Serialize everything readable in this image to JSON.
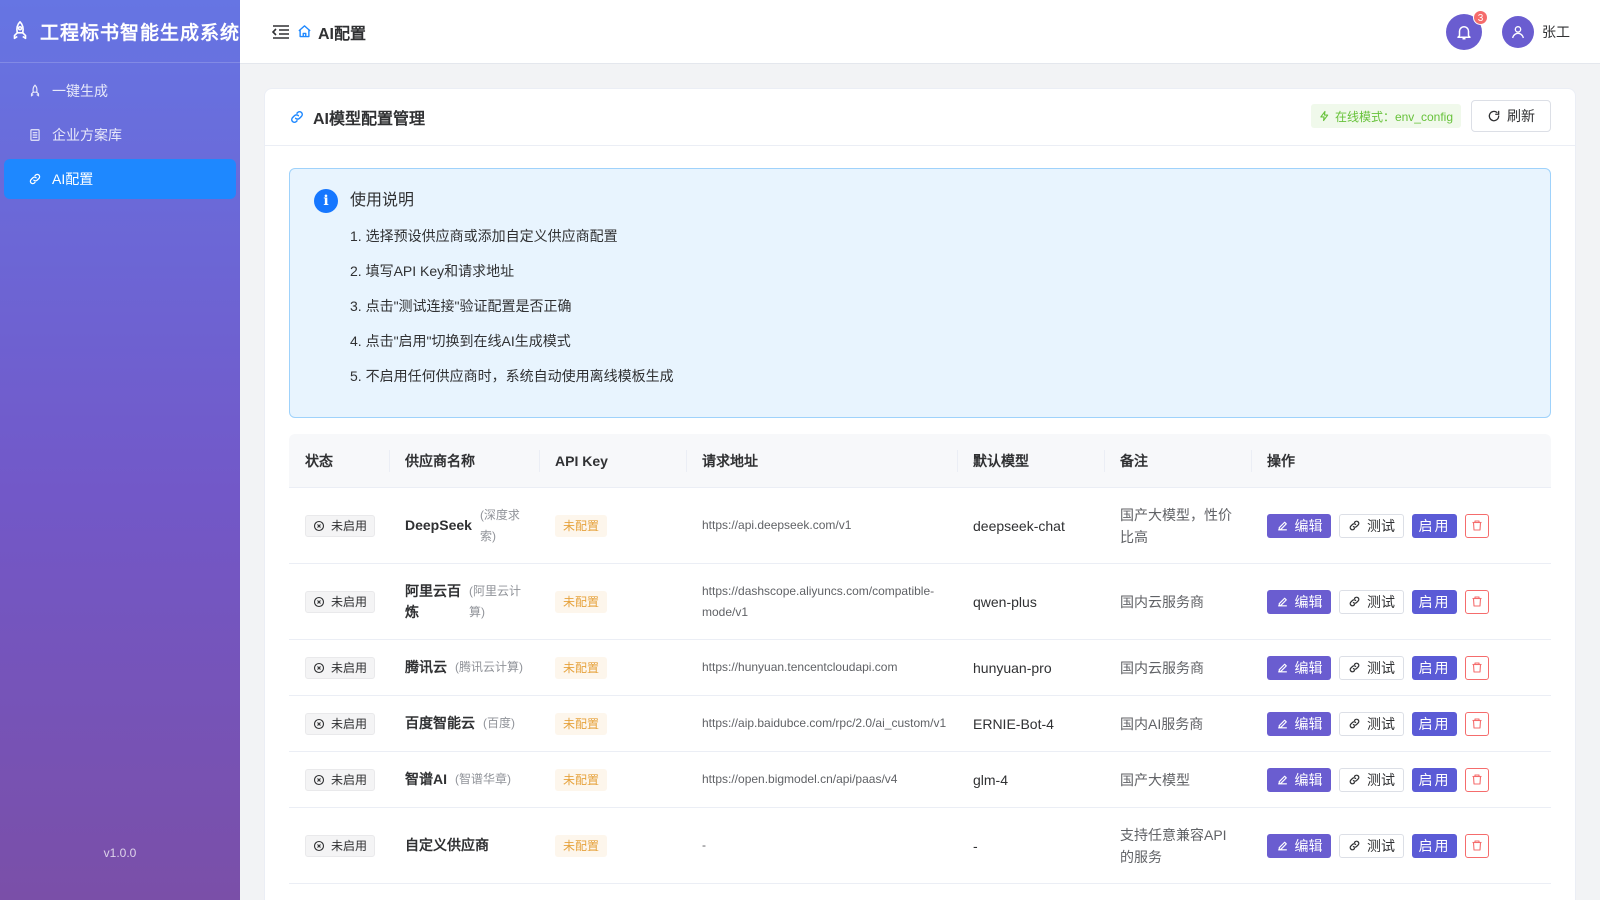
{
  "app": {
    "title": "工程标书智能生成系统",
    "version": "v1.0.0"
  },
  "sidebar": {
    "items": [
      {
        "label": "一键生成",
        "icon": "rocket-icon",
        "active": false
      },
      {
        "label": "企业方案库",
        "icon": "document-icon",
        "active": false
      },
      {
        "label": "AI配置",
        "icon": "link-icon",
        "active": true
      }
    ]
  },
  "header": {
    "breadcrumb": "AI配置",
    "notification_count": "3",
    "user": "张工"
  },
  "card": {
    "title": "AI模型配置管理",
    "mode_tag": "在线模式：env_config",
    "refresh_label": "刷新"
  },
  "alert": {
    "title": "使用说明",
    "items": [
      "1. 选择预设供应商或添加自定义供应商配置",
      "2. 填写API Key和请求地址",
      "3. 点击\"测试连接\"验证配置是否正确",
      "4. 点击\"启用\"切换到在线AI生成模式",
      "5. 不启用任何供应商时，系统自动使用离线模板生成"
    ]
  },
  "table": {
    "columns": [
      "状态",
      "供应商名称",
      "API Key",
      "请求地址",
      "默认模型",
      "备注",
      "操作"
    ],
    "actions": {
      "edit": "编辑",
      "test": "测试",
      "enable": "启用"
    },
    "rows": [
      {
        "status": "未启用",
        "name_line1": "DeepSeek",
        "name_line2": "",
        "sub_line1": "(深度求",
        "sub_line2": "索)",
        "api_key": "未配置",
        "url_line1": "https://api.deepseek.com/v1",
        "url_line2": "",
        "model": "deepseek-chat",
        "note_line1": "国产大模型，性价",
        "note_line2": "比高"
      },
      {
        "status": "未启用",
        "name_line1": "阿里云百",
        "name_line2": "炼",
        "sub_line1": "(阿里云计",
        "sub_line2": "算)",
        "api_key": "未配置",
        "url_line1": "https://dashscope.aliyuncs.com/compatible-",
        "url_line2": "mode/v1",
        "model": "qwen-plus",
        "note_line1": "国内云服务商",
        "note_line2": ""
      },
      {
        "status": "未启用",
        "name_line1": "腾讯云",
        "name_line2": "",
        "sub_line1": "(腾讯云计算)",
        "sub_line2": "",
        "api_key": "未配置",
        "url_line1": "https://hunyuan.tencentcloudapi.com",
        "url_line2": "",
        "model": "hunyuan-pro",
        "note_line1": "国内云服务商",
        "note_line2": ""
      },
      {
        "status": "未启用",
        "name_line1": "百度智能云",
        "name_line2": "",
        "sub_line1": "(百度)",
        "sub_line2": "",
        "api_key": "未配置",
        "url_line1": "https://aip.baidubce.com/rpc/2.0/ai_custom/v1",
        "url_line2": "",
        "model": "ERNIE-Bot-4",
        "note_line1": "国内AI服务商",
        "note_line2": ""
      },
      {
        "status": "未启用",
        "name_line1": "智谱AI",
        "name_line2": "",
        "sub_line1": "(智谱华章)",
        "sub_line2": "",
        "api_key": "未配置",
        "url_line1": "https://open.bigmodel.cn/api/paas/v4",
        "url_line2": "",
        "model": "glm-4",
        "note_line1": "国产大模型",
        "note_line2": ""
      },
      {
        "status": "未启用",
        "name_line1": "自定义供应商",
        "name_line2": "",
        "sub_line1": "",
        "sub_line2": "",
        "api_key": "未配置",
        "url_line1": "-",
        "url_line2": "",
        "model": "-",
        "note_line1": "支持任意兼容API",
        "note_line2": "的服务"
      }
    ]
  }
}
